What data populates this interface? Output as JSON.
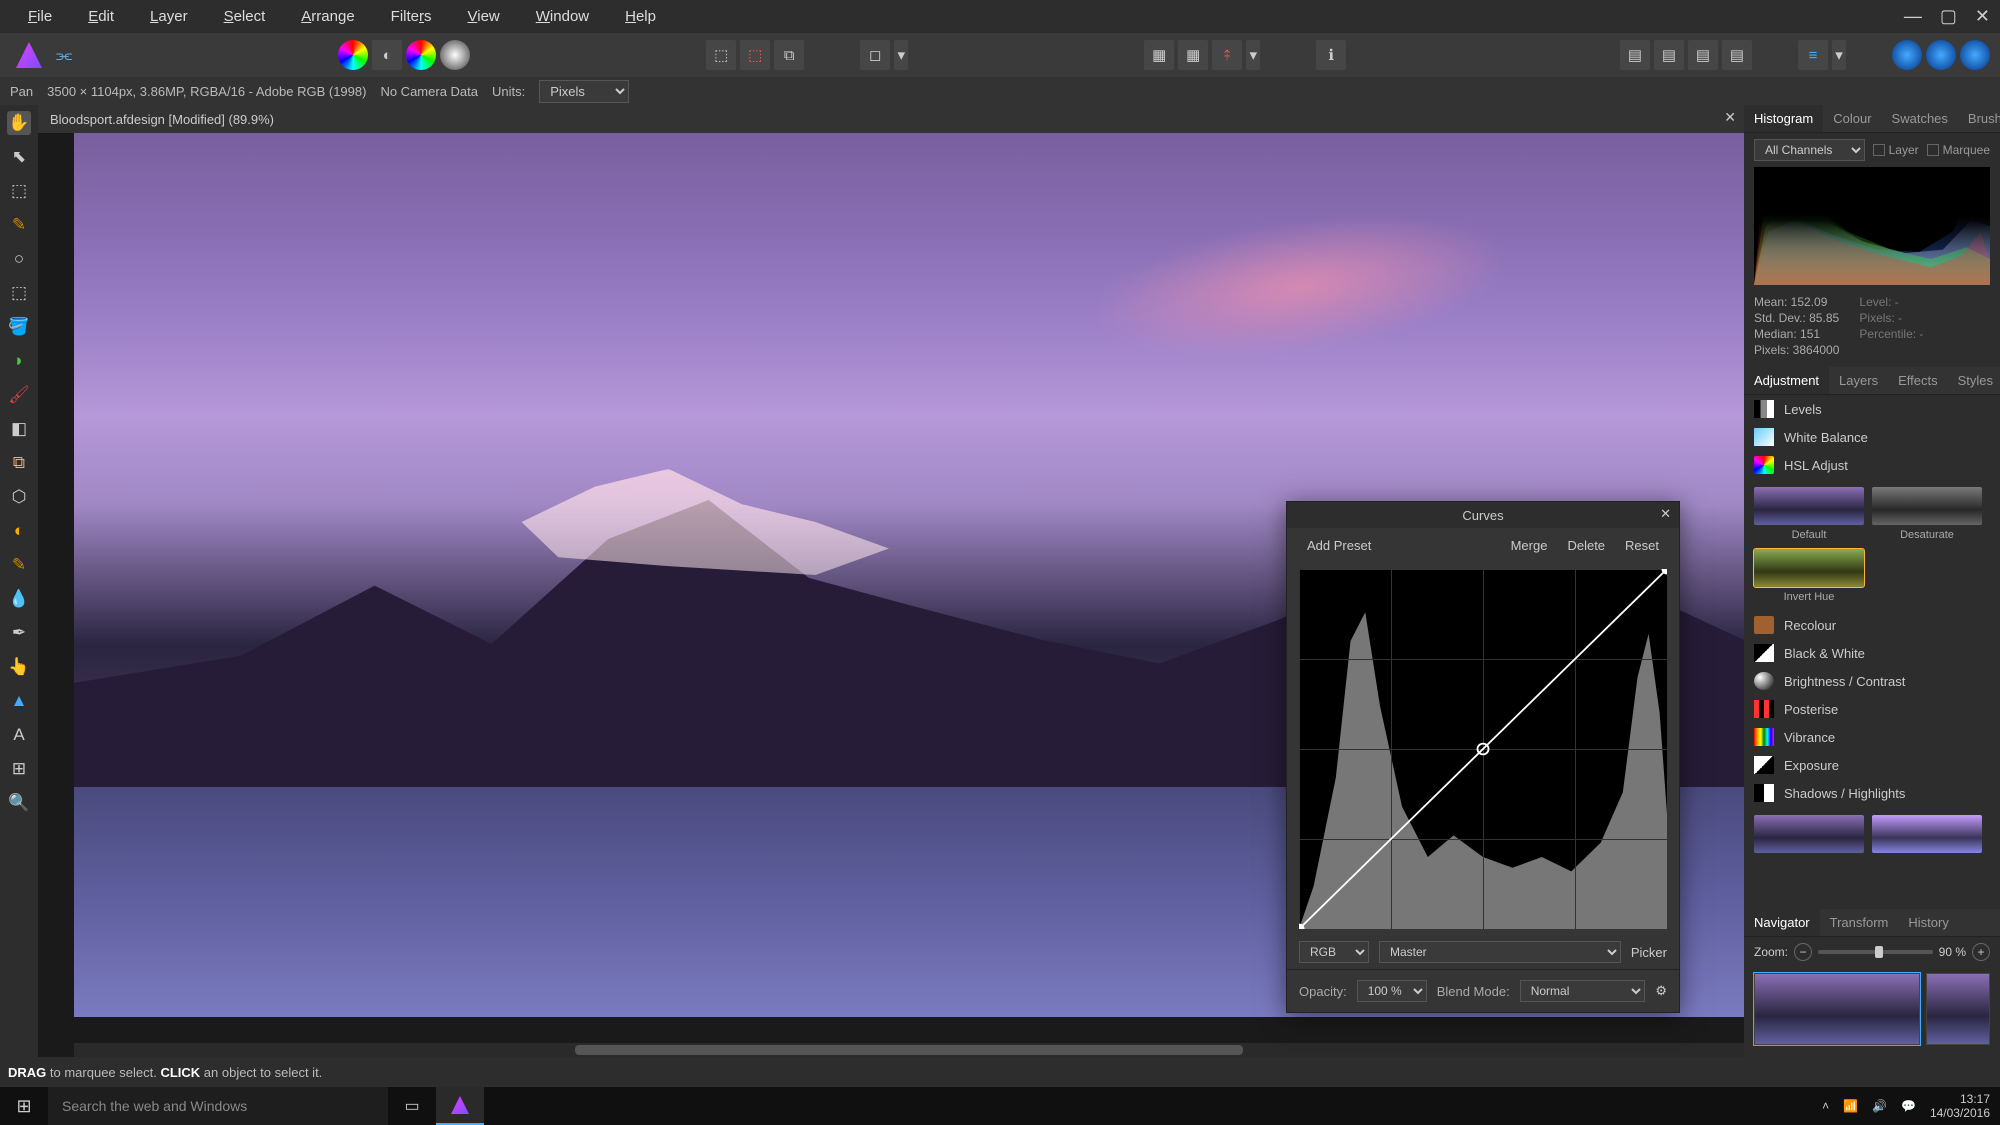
{
  "menubar": {
    "items": [
      "File",
      "Edit",
      "Layer",
      "Select",
      "Arrange",
      "Filters",
      "View",
      "Window",
      "Help"
    ]
  },
  "contextbar": {
    "tool": "Pan",
    "dimensions": "3500 × 1104px, 3.86MP, RGBA/16 - Adobe RGB (1998)",
    "camera": "No Camera Data",
    "units_label": "Units:",
    "units_value": "Pixels"
  },
  "document": {
    "tab_title": "Bloodsport.afdesign [Modified] (89.9%)"
  },
  "panels": {
    "histogram_tabs": [
      "Histogram",
      "Colour",
      "Swatches",
      "Brushes"
    ],
    "histogram": {
      "channel_select": "All Channels",
      "layer_label": "Layer",
      "marquee_label": "Marquee",
      "stats_left": {
        "mean": "Mean: 152.09",
        "stddev": "Std. Dev.: 85.85",
        "median": "Median: 151",
        "pixels": "Pixels: 3864000"
      },
      "stats_right": {
        "level": "Level: -",
        "pixels": "Pixels: -",
        "percentile": "Percentile: -"
      }
    },
    "adjustment_tabs": [
      "Adjustment",
      "Layers",
      "Effects",
      "Styles"
    ],
    "adjustments": [
      "Levels",
      "White Balance",
      "HSL Adjust",
      "Recolour",
      "Black & White",
      "Brightness / Contrast",
      "Posterise",
      "Vibrance",
      "Exposure",
      "Shadows / Highlights"
    ],
    "hsl_presets": [
      "Default",
      "Desaturate",
      "Invert Hue"
    ],
    "navigator_tabs": [
      "Navigator",
      "Transform",
      "History"
    ],
    "navigator": {
      "zoom_label": "Zoom:",
      "zoom_value": "90 %"
    }
  },
  "curves": {
    "title": "Curves",
    "add_preset": "Add Preset",
    "merge": "Merge",
    "delete": "Delete",
    "reset": "Reset",
    "colorspace": "RGB",
    "channel": "Master",
    "picker": "Picker",
    "opacity_label": "Opacity:",
    "opacity_value": "100 %",
    "blendmode_label": "Blend Mode:",
    "blendmode_value": "Normal"
  },
  "hintbar": {
    "drag": "DRAG",
    "drag_text": " to marquee select. ",
    "click": "CLICK",
    "click_text": " an object to select it."
  },
  "taskbar": {
    "search_placeholder": "Search the web and Windows",
    "time": "13:17",
    "date": "14/03/2016"
  }
}
